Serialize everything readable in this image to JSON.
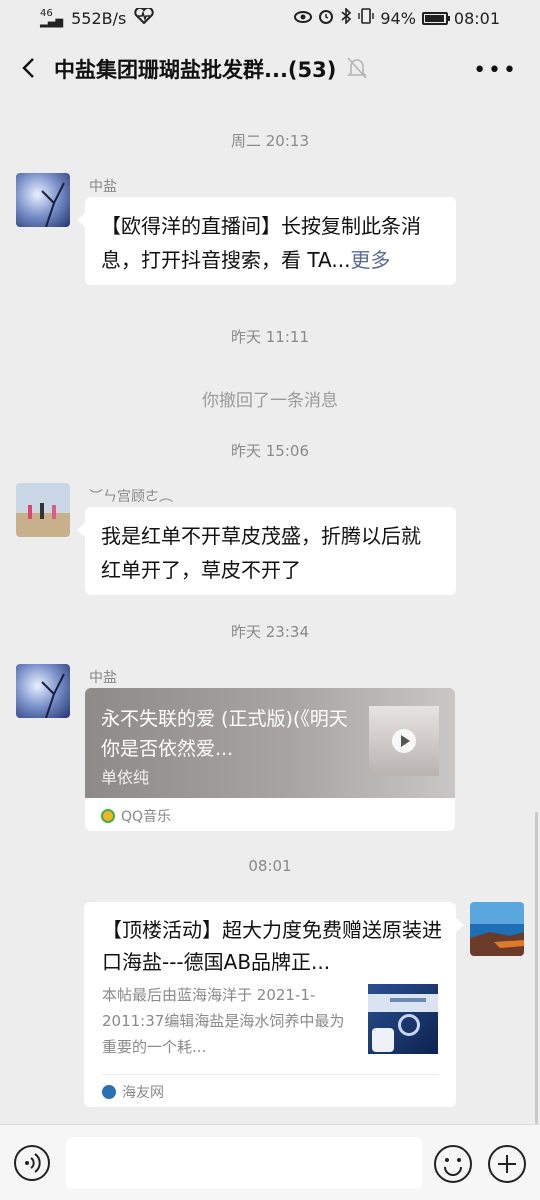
{
  "status_bar": {
    "network": "46",
    "speed": "552B/s",
    "battery": "94%",
    "battery_level": 0.94,
    "time": "08:01",
    "icons": [
      "signal-icon",
      "health-icon",
      "eye-icon",
      "alarm-icon",
      "bluetooth-icon",
      "vibrate-icon",
      "battery-icon"
    ]
  },
  "header": {
    "title": "中盐集团珊瑚盐批发群...(53)",
    "back_icon": "back-chevron-icon",
    "mute_icon": "mute-bell-icon",
    "more_label": "•••"
  },
  "messages": [
    {
      "type": "time",
      "text": "周二 20:13"
    },
    {
      "type": "text",
      "sender": "中盐",
      "text_main": "【欧得洋的直播间】长按复制此条消息，打开抖音搜索，看 TA...",
      "more": "更多"
    },
    {
      "type": "time",
      "text": "昨天 11:11"
    },
    {
      "type": "system",
      "text": "你撤回了一条消息"
    },
    {
      "type": "time",
      "text": "昨天 15:06"
    },
    {
      "type": "text",
      "sender": "︶ㄣ宫顾ㄜ︵",
      "text_main": "我是红单不开草皮茂盛，折腾以后就红单开了，草皮不开了"
    },
    {
      "type": "time",
      "text": "昨天 23:34"
    },
    {
      "type": "music",
      "sender": "中盐",
      "song": "永不失联的爱 (正式版)(《明天你是否依然爱...",
      "artist": "单依纯",
      "source": "QQ音乐"
    },
    {
      "type": "time",
      "text": "08:01"
    },
    {
      "type": "article",
      "sender": "self",
      "title": "【顶楼活动】超大力度免费赠送原装进口海盐---德国AB品牌正...",
      "desc": "本帖最后由蓝海海洋于 2021-1-2011:37编辑海盐是海水饲养中最为重要的一个耗...",
      "source": "海友网"
    }
  ],
  "input_bar": {
    "voice_icon": "voice-icon",
    "emoji_icon": "emoji-icon",
    "plus_icon": "plus-icon",
    "text_value": ""
  }
}
